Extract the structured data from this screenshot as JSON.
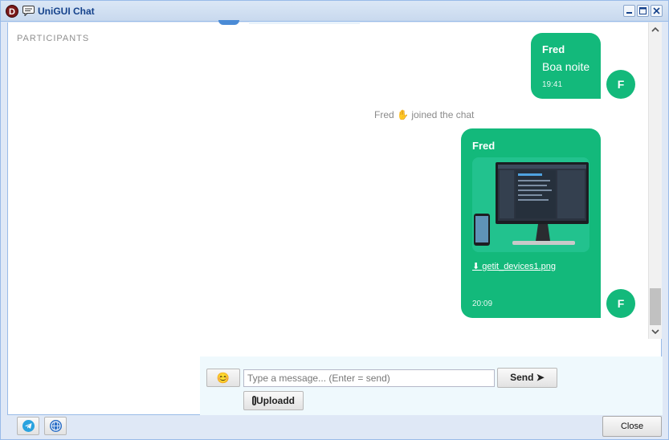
{
  "window": {
    "title": "UniGUI Chat",
    "logo_letter": "D"
  },
  "sidebar": {
    "heading": "PARTICIPANTS"
  },
  "messages": [
    {
      "sender": "Fred",
      "text": "Boa noite",
      "time": "19:41",
      "avatar": "F"
    },
    {
      "system": true,
      "user": "Fred",
      "emoji": "waving-hand",
      "text": "joined the chat"
    },
    {
      "sender": "Fred",
      "attachment": "getit_devices1.png",
      "time": "20:09",
      "avatar": "F"
    }
  ],
  "composer": {
    "emoji_icon": "smiley-icon",
    "placeholder": "Type a message... (Enter = send)",
    "send_label": "Send ➤",
    "upload_label": "Uploadd"
  },
  "footer": {
    "icons": [
      "telegram-icon",
      "web-icon"
    ],
    "close_label": "Close"
  },
  "colors": {
    "bubble": "#13b97b",
    "title": "#15428b",
    "window_border": "#99bbe8"
  }
}
